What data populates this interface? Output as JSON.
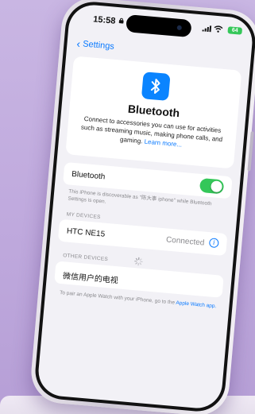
{
  "status_bar": {
    "time": "15:58",
    "battery": "64"
  },
  "nav": {
    "back_label": "Settings"
  },
  "header": {
    "title": "Bluetooth",
    "description": "Connect to accessories you can use for activities such as streaming music, making phone calls, and gaming.",
    "learn_more": "Learn more..."
  },
  "toggle_row": {
    "label": "Bluetooth",
    "enabled": true
  },
  "discoverable_note": "This iPhone is discoverable as \"陈大事 iphone\" while Bluetooth Settings is open.",
  "my_devices": {
    "header": "MY DEVICES",
    "items": [
      {
        "name": "HTC NE15",
        "status": "Connected"
      }
    ]
  },
  "other_devices": {
    "header": "OTHER DEVICES",
    "items": [
      {
        "name": "微信用户的电视"
      }
    ]
  },
  "apple_watch_note": {
    "text": "To pair an Apple Watch with your iPhone, go to the",
    "link": "Apple Watch app."
  },
  "colors": {
    "accent": "#0a7aff",
    "toggle_on": "#34c759",
    "bluetooth_badge": "#0a84ff",
    "background": "#c9b6e3"
  }
}
